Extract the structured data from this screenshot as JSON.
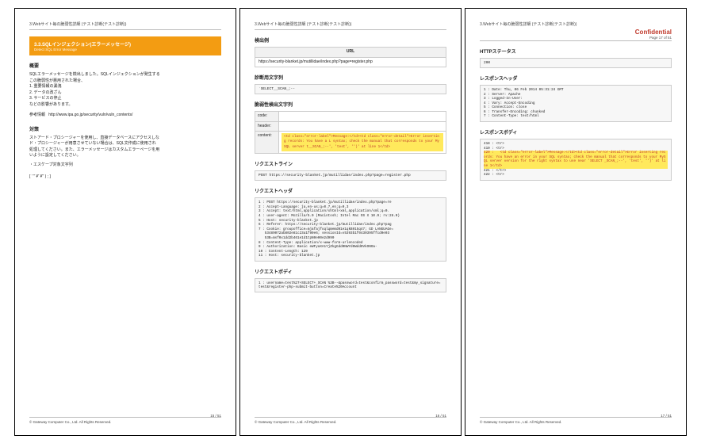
{
  "breadcrumb": "3.Webサイト毎の脆弱性詳細 (テスト診断(テスト診断))",
  "confidential": {
    "label": "Confidential",
    "sub": "Page 17 of 51"
  },
  "footer": "© Gateway Computer Co., Ltd. All Rights Reserved.",
  "pagenums": {
    "p15": "15 / 51",
    "p16": "16 / 51",
    "p17": "17 / 51"
  },
  "p15": {
    "bar_title": "3.3.SQLインジェクション(エラーメッセージ)",
    "bar_sub": "Detect SQL Error Message",
    "h_overview": "概要",
    "overview1": "SQLエラーメッセージを検出しました。SQLインジェクションが発生する",
    "overview2": "この脆弱性が悪用された場合、",
    "impacts": {
      "i1": "1. 重要情報の漏洩",
      "i2": "2. データの改ざん",
      "i3": "3. サービスの停止"
    },
    "impact_tail": "などの影響があります。",
    "ref_label": "参考情報",
    "ref_url": "http://www.ipa.go.jp/security/vuln/vuln_contents/",
    "h_counter": "対策",
    "counter1": "ストアード・プロシージャーを使用し、直接データベースにアクセスしな",
    "counter2": "ド・プロシージャーが用意させていない場合は、SQL文作成に使用され",
    "counter3": "処理してください。また、エラーメッセージはカスタムエラーページを用",
    "counter4": "いように設定してください。",
    "esc_label": "・エスケープ対象文字列",
    "esc_chars": "[ ' '' ¥' ¥'' ) ; ]"
  },
  "p16": {
    "h_detect": "検出例",
    "url_header": "URL",
    "url_value": "https://security-blanket.jp/mutillidae/index.php?page=register.php",
    "h_diag": "診断用文字列",
    "diag_value": "`SELECT__SCAN_;--",
    "h_vuln": "脆弱性検出文字列",
    "kv": {
      "code_label": "code:",
      "header_label": "header:",
      "content_label": "content:",
      "content_value": "<td class=\"error-label\">Message:</td><td class=\"error-detail\">Error inserting records: You have a L syntax; check the manual that corresponds to your MySQL server t__SCAN_;--', 'test', '')' at line 1</td>"
    },
    "h_reqline": "リクエストライン",
    "reqline": "POST https://security-blanket.jp/mutillidae/index.php?page=register.php",
    "h_reqheader": "リクエストヘッダ",
    "reqheaders": [
      "1 : POST https://security-blanket.jp/mutillidae/index.php?page=re",
      "2 : Accept-Language: ja,en-us;q=0.7,en;q=0.3",
      "3 : Accept: text/html,application/xhtml+xml,application/xml;q=0.",
      "4 : user-agent: Mozilla/5.0 (Macintosh; Intel Mac OS X 10.9; rv:26.0)",
      "5 : Host: security-blanket.jp",
      "6 : Referer: https://security-blanket.jp/mutillidae/index.php?pag",
      "7 : Cookie: groupoffice=mjafajfoqlqmemd01e1qkB915q47; GD LANGUAGe=",
      "   53489072ab802e81c23a1f90e6; sessionId=v5393b1f0430395ffcd0e03",
      "   53B=msf0x1dd2b461e1d1tpN0e00e2d990",
      "8 : Content-Type: application/x-www-form-urlencoded",
      "9 : Authorization: Basic eWFyaXA1YjZkgGdd0NWYd0Wdd0VkONOa-",
      "10 : Content-Length: 129",
      "11 : Host: security-blanket.jp"
    ],
    "h_reqbody": "リクエストボディ",
    "reqbody": "1 : username=test%27+SELECT+_SCAN %3B--&password=test&confirm_password=test&my_signature=test&register-php-submit-button=Create%20Account"
  },
  "p17": {
    "h_status": "HTTPステータス",
    "status": "200",
    "h_resheader": "レスポンスヘッダ",
    "resheaders": [
      "1 : Date: Thu, 06 Feb 2014 05:31:24 GMT",
      "2 : Server: Apache",
      "3 : Logged-In-User:",
      "4 : Vary: Accept-Encoding",
      "5 : Connection: close",
      "6 : Transfer-Encoding: chunked",
      "7 : Content-Type: text/html"
    ],
    "h_resbody": "レスポンスボディ",
    "resbody_pre": [
      "418 : <tr>",
      "419 : <tr>"
    ],
    "resbody_hl": "420 : \t<td class=\"error-label\">Message:</td><td class=\"error-detail\">Error inserting records: You have an error in your SQL syntax; check the manual that corresponds to your MySQL server version for the right syntax to use near 'SELECT _SCAN_;--', 'test', '')' at line 1</td>",
    "resbody_post": [
      "421 : </tr>",
      "422 : <tr>"
    ]
  }
}
